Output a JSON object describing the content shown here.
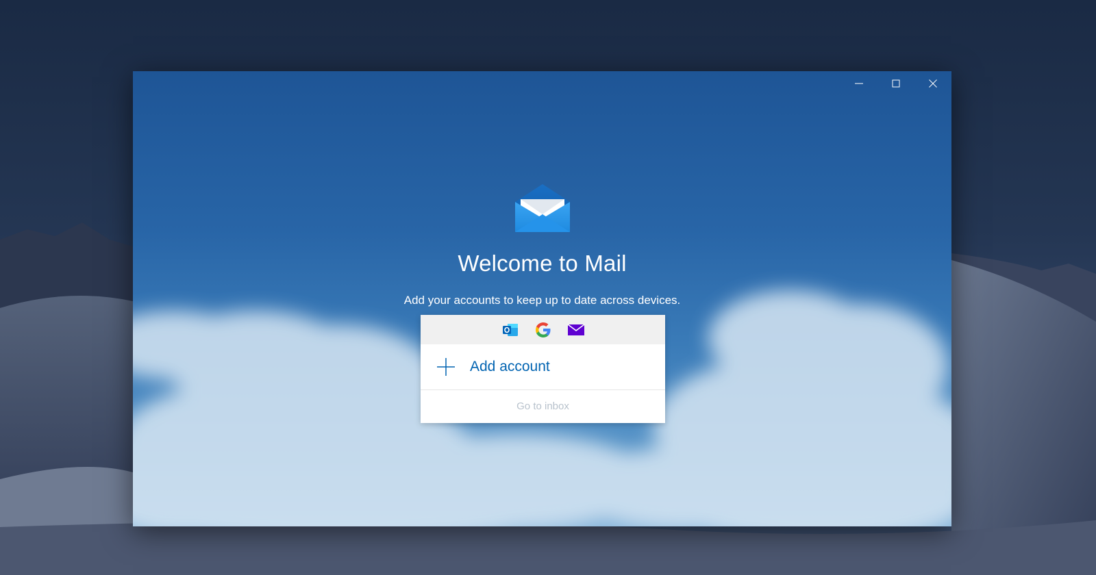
{
  "window": {
    "controls": {
      "minimize_icon": "minimize-icon",
      "maximize_icon": "maximize-icon",
      "close_icon": "close-icon"
    }
  },
  "welcome": {
    "app_icon": "mail-envelope-icon",
    "title": "Welcome to Mail",
    "subtitle": "Add your accounts to keep up to date across devices."
  },
  "accounts_card": {
    "providers": [
      "outlook-icon",
      "google-icon",
      "mail-icon"
    ],
    "add_account_icon": "plus-icon",
    "add_account_label": "Add account",
    "go_to_inbox_label": "Go to inbox"
  },
  "colors": {
    "accent": "#0063b1",
    "window_top": "#1e5596",
    "window_bottom": "#7eafd8",
    "disabled_text": "#b8c2cc",
    "provider_strip": "#f0f0f0",
    "yahoo_purple": "#5f01d1"
  }
}
